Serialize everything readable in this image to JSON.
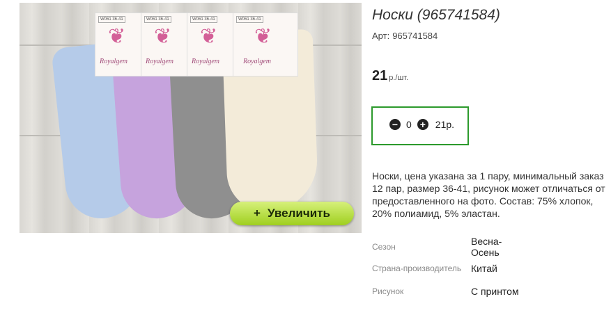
{
  "product": {
    "title": "Носки (965741584)",
    "sku_label": "Арт:",
    "sku_value": "965741584",
    "price": "21",
    "price_unit": "р./шт.",
    "description": "Носки, цена указана за 1 пару, минимальный заказ 12 пар, размер 36-41, рисунок может отличаться от предоставленного на фото. Состав: 75% хлопок, 20% полиамид, 5% эластан."
  },
  "image": {
    "zoom_label": "Увеличить",
    "zoom_icon": "+",
    "tag_brand": "Royalgem",
    "tag_code": "W061 36-41"
  },
  "quantity": {
    "minus_icon": "minus-circle-icon",
    "plus_icon": "plus-circle-icon",
    "value": "0",
    "total": "21р."
  },
  "properties": [
    {
      "key": "Сезон",
      "value": "Весна-Осень"
    },
    {
      "key": "Страна-производитель",
      "value": "Китай"
    },
    {
      "key": "Рисунок",
      "value": "С принтом"
    }
  ],
  "colors": {
    "accent_border": "#2c9a2c",
    "zoom_button": "#b4dd3c"
  }
}
